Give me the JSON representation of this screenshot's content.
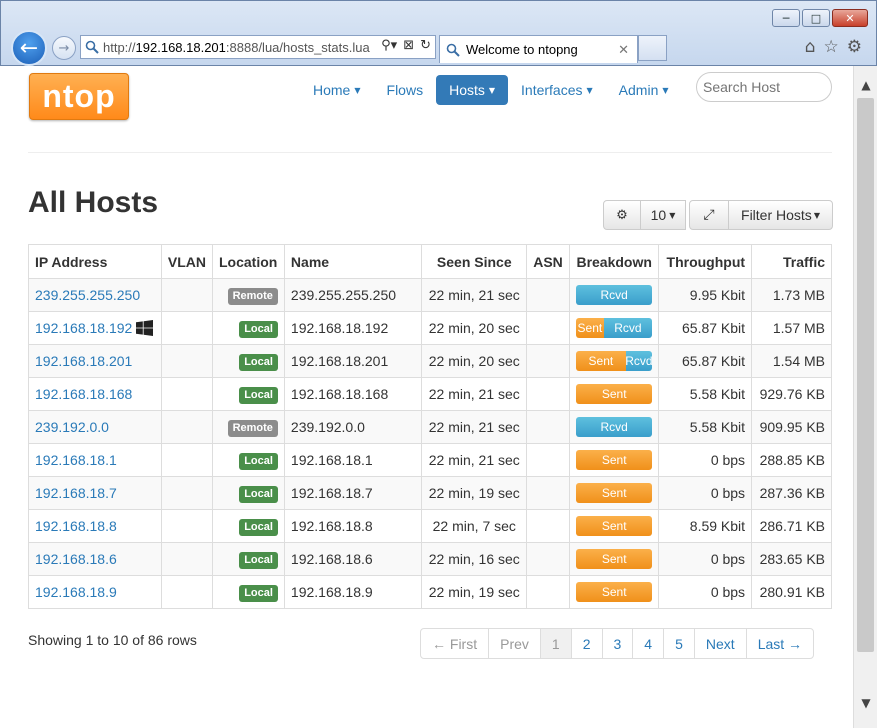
{
  "browser": {
    "url_prefix": "http://",
    "url_host": "192.168.18.201",
    "url_rest": ":8888/lua/hosts_stats.lua",
    "tab_title": "Welcome to ntopng",
    "minimize": "─",
    "maximize": "□",
    "close": "✕",
    "back": "←",
    "forward": "→",
    "tab_close": "✕",
    "addr_tools": [
      "⚲▾",
      "⊠",
      "↻"
    ],
    "right_icons": [
      "⌂",
      "☆",
      "⚙"
    ]
  },
  "scrollbar": {
    "up": "▲",
    "down": "▼"
  },
  "brand": {
    "logo_text": "ntop"
  },
  "nav": {
    "items": [
      {
        "label": "Home",
        "caret": "▼"
      },
      {
        "label": "Flows",
        "caret": ""
      },
      {
        "label": "Hosts",
        "caret": "▼"
      },
      {
        "label": "Interfaces",
        "caret": "▼"
      },
      {
        "label": "Admin",
        "caret": "▼"
      }
    ],
    "search_placeholder": "Search Host"
  },
  "page": {
    "title": "All Hosts"
  },
  "toolbar": {
    "gear": "⚙",
    "page_size": "10",
    "page_size_caret": "▼",
    "expand": "⤢",
    "filter_label": "Filter Hosts",
    "filter_caret": "▼"
  },
  "table": {
    "columns": [
      "IP Address",
      "VLAN",
      "Location",
      "Name",
      "Seen Since",
      "ASN",
      "Breakdown",
      "Throughput",
      "Traffic"
    ],
    "rows": [
      {
        "ip": "239.255.255.250",
        "windows": false,
        "vlan": "",
        "location": "Remote",
        "name": "239.255.255.250",
        "seen": "22 min, 21 sec",
        "asn": "",
        "sent_pct": 0,
        "rcvd_pct": 100,
        "sent_label": "",
        "rcvd_label": "Rcvd",
        "throughput": "9.95 Kbit",
        "traffic": "1.73 MB"
      },
      {
        "ip": "192.168.18.192",
        "windows": true,
        "vlan": "",
        "location": "Local",
        "name": "192.168.18.192",
        "seen": "22 min, 20 sec",
        "asn": "",
        "sent_pct": 36,
        "rcvd_pct": 64,
        "sent_label": "Sent",
        "rcvd_label": "Rcvd",
        "throughput": "65.87 Kbit",
        "traffic": "1.57 MB"
      },
      {
        "ip": "192.168.18.201",
        "windows": false,
        "vlan": "",
        "location": "Local",
        "name": "192.168.18.201",
        "seen": "22 min, 20 sec",
        "asn": "",
        "sent_pct": 65,
        "rcvd_pct": 35,
        "sent_label": "Sent",
        "rcvd_label": "Rcvd",
        "throughput": "65.87 Kbit",
        "traffic": "1.54 MB"
      },
      {
        "ip": "192.168.18.168",
        "windows": false,
        "vlan": "",
        "location": "Local",
        "name": "192.168.18.168",
        "seen": "22 min, 21 sec",
        "asn": "",
        "sent_pct": 100,
        "rcvd_pct": 0,
        "sent_label": "Sent",
        "rcvd_label": "",
        "throughput": "5.58 Kbit",
        "traffic": "929.76 KB"
      },
      {
        "ip": "239.192.0.0",
        "windows": false,
        "vlan": "",
        "location": "Remote",
        "name": "239.192.0.0",
        "seen": "22 min, 21 sec",
        "asn": "",
        "sent_pct": 0,
        "rcvd_pct": 100,
        "sent_label": "",
        "rcvd_label": "Rcvd",
        "throughput": "5.58 Kbit",
        "traffic": "909.95 KB"
      },
      {
        "ip": "192.168.18.1",
        "windows": false,
        "vlan": "",
        "location": "Local",
        "name": "192.168.18.1",
        "seen": "22 min, 21 sec",
        "asn": "",
        "sent_pct": 100,
        "rcvd_pct": 0,
        "sent_label": "Sent",
        "rcvd_label": "",
        "throughput": "0 bps",
        "traffic": "288.85 KB"
      },
      {
        "ip": "192.168.18.7",
        "windows": false,
        "vlan": "",
        "location": "Local",
        "name": "192.168.18.7",
        "seen": "22 min, 19 sec",
        "asn": "",
        "sent_pct": 100,
        "rcvd_pct": 0,
        "sent_label": "Sent",
        "rcvd_label": "",
        "throughput": "0 bps",
        "traffic": "287.36 KB"
      },
      {
        "ip": "192.168.18.8",
        "windows": false,
        "vlan": "",
        "location": "Local",
        "name": "192.168.18.8",
        "seen": "22 min, 7 sec",
        "asn": "",
        "sent_pct": 100,
        "rcvd_pct": 0,
        "sent_label": "Sent",
        "rcvd_label": "",
        "throughput": "8.59 Kbit",
        "traffic": "286.71 KB"
      },
      {
        "ip": "192.168.18.6",
        "windows": false,
        "vlan": "",
        "location": "Local",
        "name": "192.168.18.6",
        "seen": "22 min, 16 sec",
        "asn": "",
        "sent_pct": 100,
        "rcvd_pct": 0,
        "sent_label": "Sent",
        "rcvd_label": "",
        "throughput": "0 bps",
        "traffic": "283.65 KB"
      },
      {
        "ip": "192.168.18.9",
        "windows": false,
        "vlan": "",
        "location": "Local",
        "name": "192.168.18.9",
        "seen": "22 min, 19 sec",
        "asn": "",
        "sent_pct": 100,
        "rcvd_pct": 0,
        "sent_label": "Sent",
        "rcvd_label": "",
        "throughput": "0 bps",
        "traffic": "280.91 KB"
      }
    ]
  },
  "footer": {
    "showing": "Showing 1 to 10 of 86 rows",
    "pager": [
      {
        "label": "← First",
        "state": "disabled"
      },
      {
        "label": "Prev",
        "state": "disabled"
      },
      {
        "label": "1",
        "state": "current"
      },
      {
        "label": "2",
        "state": ""
      },
      {
        "label": "3",
        "state": ""
      },
      {
        "label": "4",
        "state": ""
      },
      {
        "label": "5",
        "state": ""
      },
      {
        "label": "Next",
        "state": ""
      },
      {
        "label": "Last →",
        "state": ""
      }
    ]
  }
}
